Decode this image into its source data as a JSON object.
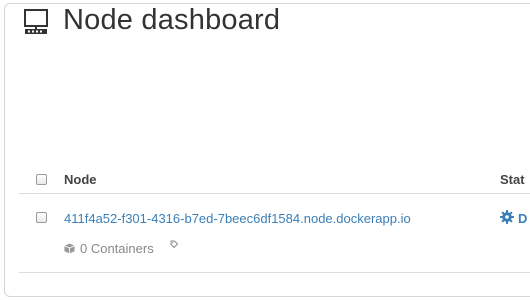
{
  "header": {
    "title": "Node dashboard",
    "icon": "server-icon"
  },
  "table": {
    "columns": [
      "Node",
      "Stat"
    ],
    "rows": [
      {
        "node": "411f4a52-f301-4316-b7ed-7beec6df1584.node.dockerapp.io",
        "containers": "0 Containers",
        "status_icon": "gear-icon",
        "status": "D"
      }
    ]
  },
  "colors": {
    "link": "#3b7fb6",
    "text": "#333333",
    "muted": "#888888"
  }
}
